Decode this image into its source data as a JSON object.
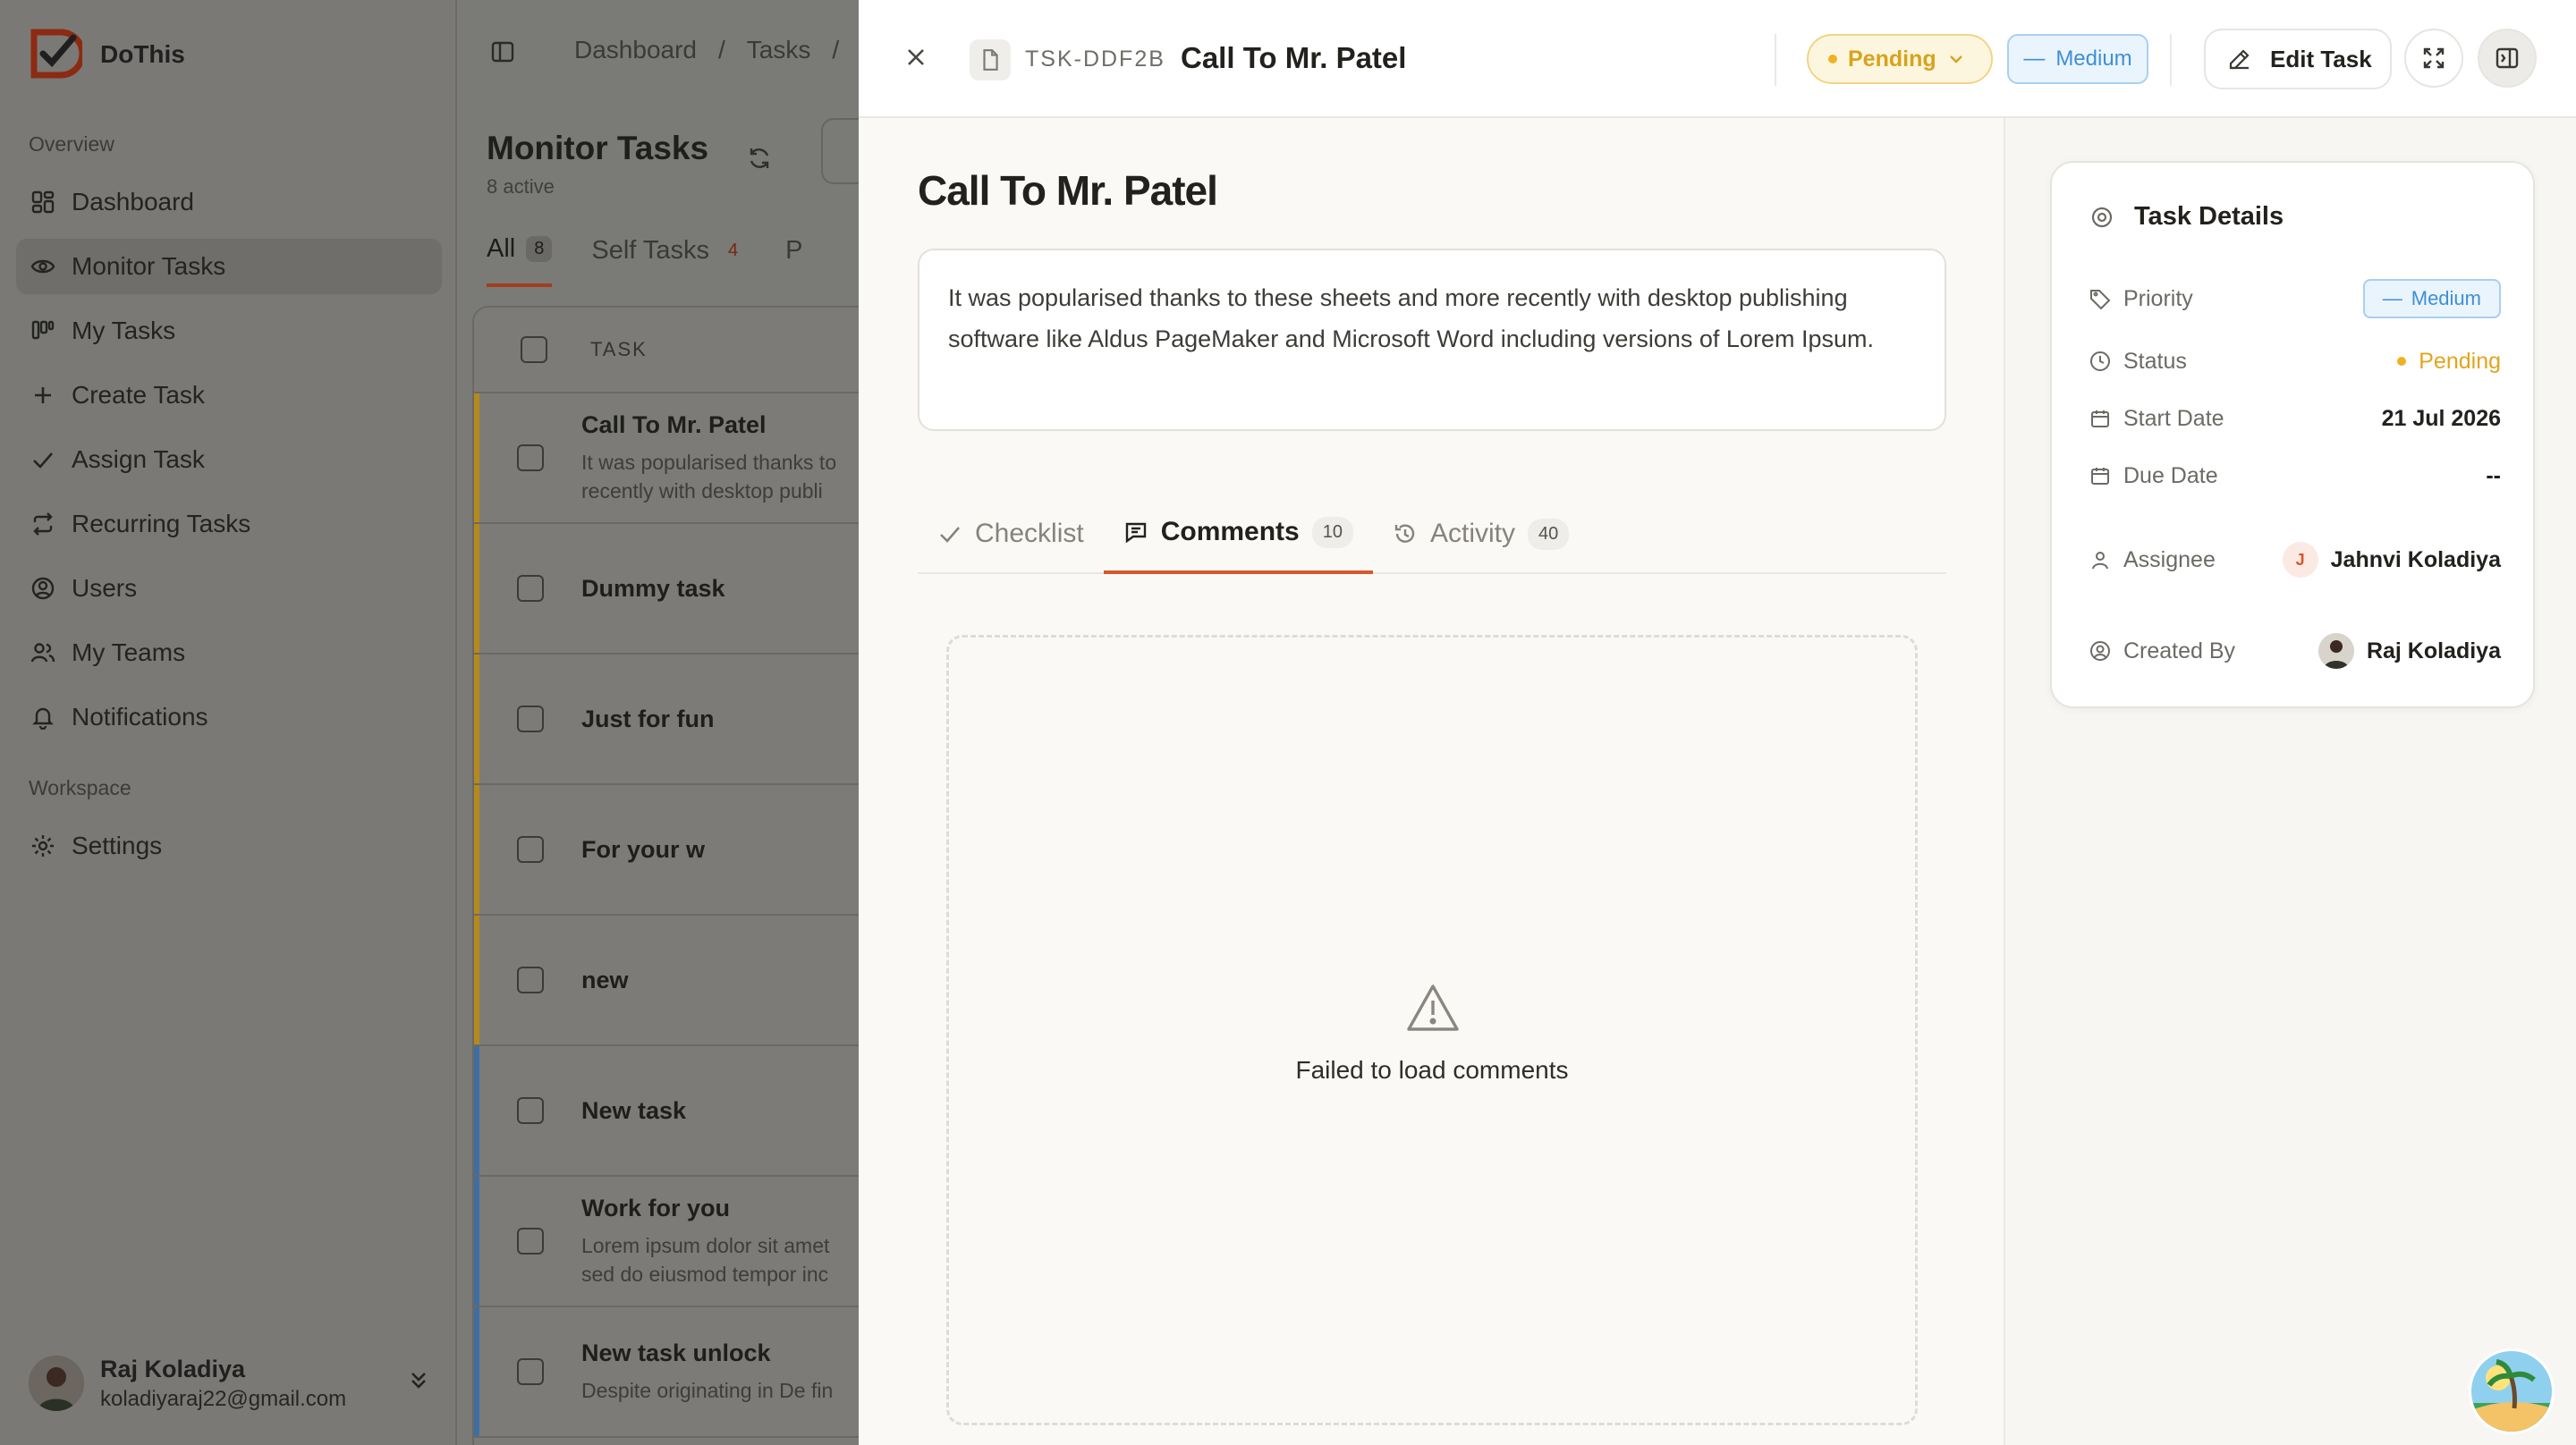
{
  "app": {
    "name": "DoThis"
  },
  "sidebar": {
    "overview_label": "Overview",
    "workspace_label": "Workspace",
    "items": [
      {
        "label": "Dashboard",
        "icon": "dashboard-icon"
      },
      {
        "label": "Monitor Tasks",
        "icon": "eye-icon",
        "active": true
      },
      {
        "label": "My Tasks",
        "icon": "kanban-icon"
      },
      {
        "label": "Create Task",
        "icon": "plus-icon"
      },
      {
        "label": "Assign Task",
        "icon": "check-icon"
      },
      {
        "label": "Recurring Tasks",
        "icon": "repeat-icon"
      },
      {
        "label": "Users",
        "icon": "user-circle-icon"
      },
      {
        "label": "My Teams",
        "icon": "users-icon"
      },
      {
        "label": "Notifications",
        "icon": "bell-icon"
      }
    ],
    "workspace_items": [
      {
        "label": "Settings",
        "icon": "gear-icon"
      }
    ],
    "user": {
      "name": "Raj Koladiya",
      "email": "koladiyaraj22@gmail.com"
    }
  },
  "list": {
    "breadcrumb": [
      "Dashboard",
      "/",
      "Tasks",
      "/"
    ],
    "title": "Monitor Tasks",
    "subtitle": "8 active",
    "tabs": [
      {
        "label": "All",
        "count": "8"
      },
      {
        "label": "Self Tasks",
        "count": "4"
      },
      {
        "label": "P",
        "count": ""
      }
    ],
    "column_header": "TASK",
    "rows": [
      {
        "title": "Call To Mr. Patel",
        "desc1": "It was popularised thanks to",
        "desc2": "recently with desktop publi",
        "color": "#b58a1c"
      },
      {
        "title": "Dummy task",
        "desc1": "",
        "desc2": "",
        "color": "#b58a1c"
      },
      {
        "title": "Just for fun",
        "desc1": "",
        "desc2": "",
        "color": "#b58a1c"
      },
      {
        "title": "For your w",
        "desc1": "",
        "desc2": "",
        "color": "#b58a1c"
      },
      {
        "title": "new",
        "desc1": "",
        "desc2": "",
        "color": "#b58a1c"
      },
      {
        "title": "New task",
        "desc1": "",
        "desc2": "",
        "color": "#3f6ea3"
      },
      {
        "title": "Work for you",
        "desc1": "Lorem ipsum dolor sit amet",
        "desc2": "sed do eiusmod tempor inc",
        "color": "#3f6ea3"
      },
      {
        "title": "New task unlock",
        "desc1": "Despite originating in De fin",
        "desc2": "",
        "color": "#3f6ea3"
      }
    ]
  },
  "sheet": {
    "task_id": "TSK-DDF2B",
    "title": "Call To Mr. Patel",
    "status": "Pending",
    "priority": "Medium",
    "priority_dash": "—",
    "edit_label": "Edit Task",
    "heading": "Call To Mr. Patel",
    "description": "It was popularised thanks to these sheets and more recently with desktop publishing software like Aldus PageMaker and Microsoft Word including versions of Lorem Ipsum.",
    "tabs": [
      {
        "label": "Checklist",
        "count": ""
      },
      {
        "label": "Comments",
        "count": "10"
      },
      {
        "label": "Activity",
        "count": "40"
      }
    ],
    "error_text": "Failed to load comments"
  },
  "details": {
    "title": "Task Details",
    "priority_label": "Priority",
    "priority_value": "Medium",
    "status_label": "Status",
    "status_value": "Pending",
    "start_label": "Start Date",
    "start_value": "21 Jul 2026",
    "due_label": "Due Date",
    "due_value": "--",
    "assignee_label": "Assignee",
    "assignee_initial": "J",
    "assignee_value": "Jahnvi Koladiya",
    "created_label": "Created By",
    "created_value": "Raj Koladiya"
  },
  "colors": {
    "accent": "#d9572c",
    "pending": "#e3a41d",
    "medium": "#3e8fd6"
  }
}
